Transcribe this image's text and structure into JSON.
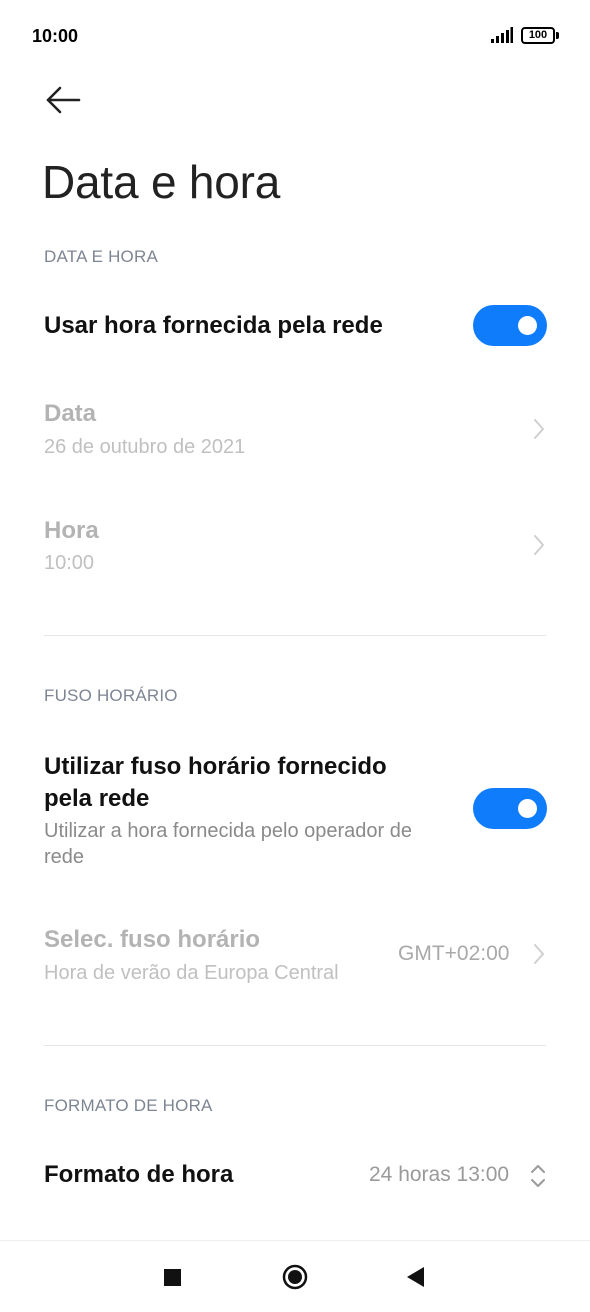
{
  "status_bar": {
    "time": "10:00",
    "battery": "100"
  },
  "page": {
    "title": "Data e hora"
  },
  "sections": {
    "date_time": "DATA E HORA",
    "timezone": "FUSO HORÁRIO",
    "time_format": "FORMATO DE HORA"
  },
  "rows": {
    "network_time": {
      "title": "Usar hora fornecida pela rede",
      "enabled": true
    },
    "date": {
      "title": "Data",
      "subtitle": "26 de outubro de 2021"
    },
    "time": {
      "title": "Hora",
      "subtitle": "10:00"
    },
    "network_timezone": {
      "title_line1": "Utilizar fuso horário fornecido",
      "title_line2": "pela rede",
      "subtitle_line1": "Utilizar a hora fornecida pelo operador de",
      "subtitle_line2": "rede",
      "enabled": true
    },
    "select_timezone": {
      "title": "Selec. fuso horário",
      "subtitle": "Hora de verão da Europa Central",
      "value": "GMT+02:00"
    },
    "time_format": {
      "title": "Formato de hora",
      "value": "24 horas 13:00"
    }
  },
  "colors": {
    "accent": "#0f7dfb",
    "section_header": "#7d8593",
    "disabled_text": "#b3b3b3"
  },
  "icons": {
    "back": "back-arrow-icon",
    "chevron": "chevron-right-icon",
    "updown": "chevron-up-down-icon",
    "nav_recents": "square-icon",
    "nav_home": "circle-icon",
    "nav_back": "triangle-back-icon"
  }
}
